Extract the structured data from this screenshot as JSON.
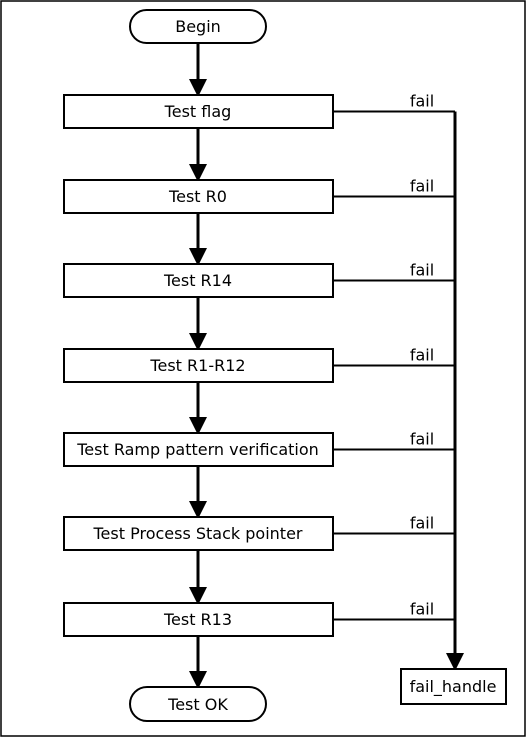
{
  "start": "Begin",
  "steps": [
    "Test flag",
    "Test R0",
    "Test R14",
    "Test R1-R12",
    "Test Ramp pattern verification",
    "Test Process Stack pointer",
    "Test R13"
  ],
  "fail_label": "fail",
  "end": "Test OK",
  "fail_target": "fail_handle"
}
